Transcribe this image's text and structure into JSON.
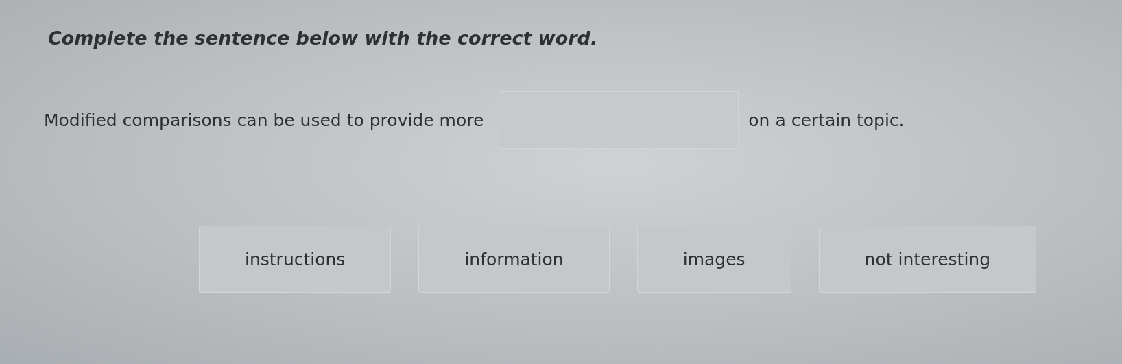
{
  "instruction": "Complete the sentence below with the correct word.",
  "sentence": {
    "before": "Modified comparisons can be used to provide more",
    "after": "on a certain topic."
  },
  "choices": [
    {
      "label": "instructions",
      "selected": false
    },
    {
      "label": "information",
      "selected": false
    },
    {
      "label": "images",
      "selected": false
    },
    {
      "label": "not interesting",
      "selected": false
    }
  ]
}
